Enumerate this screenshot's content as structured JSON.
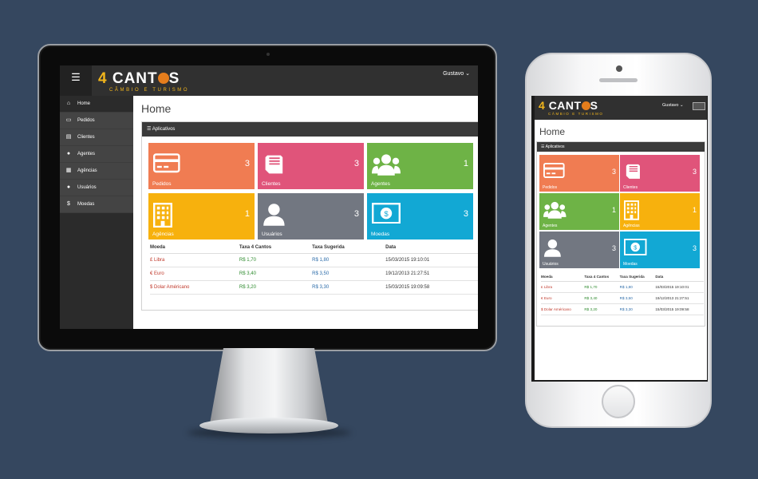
{
  "brand": {
    "number": "4",
    "name_before": "CANT",
    "name_after": "S",
    "tagline": "CÂMBIO E TURISMO"
  },
  "user": {
    "name": "Gustavo",
    "caret": "⌄"
  },
  "menu_icon": "☰",
  "page_title": "Home",
  "panel": {
    "icon": "☰",
    "title": "Aplicativos"
  },
  "sidebar": {
    "items": [
      {
        "label": "Home",
        "icon": "home-icon",
        "glyph": "⌂",
        "active": true
      },
      {
        "label": "Pedidos",
        "icon": "credit-card-icon",
        "glyph": "▭"
      },
      {
        "label": "Clientes",
        "icon": "book-icon",
        "glyph": "▤"
      },
      {
        "label": "Agentes",
        "icon": "users-icon",
        "glyph": "●"
      },
      {
        "label": "Agências",
        "icon": "building-icon",
        "glyph": "▦"
      },
      {
        "label": "Usuários",
        "icon": "user-icon",
        "glyph": "●"
      },
      {
        "label": "Moedas",
        "icon": "dollar-icon",
        "glyph": "$"
      }
    ]
  },
  "tiles": [
    {
      "label": "Pedidos",
      "value": "3",
      "color": "#f07c52",
      "icon": "credit-card-icon"
    },
    {
      "label": "Clientes",
      "value": "3",
      "color": "#e0547a",
      "icon": "book-icon"
    },
    {
      "label": "Agentes",
      "value": "1",
      "color": "#6eb346",
      "icon": "users-icon"
    },
    {
      "label": "Agências",
      "value": "1",
      "color": "#f7b10d",
      "icon": "building-icon"
    },
    {
      "label": "Usuários",
      "value": "3",
      "color": "#727781",
      "icon": "user-icon"
    },
    {
      "label": "Moedas",
      "value": "3",
      "color": "#12a8d4",
      "icon": "money-icon"
    }
  ],
  "table": {
    "headers": [
      "Moeda",
      "Taxa 4 Cantos",
      "Taxa Sugerida",
      "Data"
    ],
    "rows": [
      [
        "£ Libra",
        "R$ 1,70",
        "R$ 1,80",
        "15/03/2015 19:10:01"
      ],
      [
        "€ Euro",
        "R$ 3,40",
        "R$ 3,50",
        "19/12/2013 21:27:51"
      ],
      [
        "$ Dolar Américano",
        "R$ 3,20",
        "R$ 3,30",
        "15/03/2015 19:09:58"
      ]
    ]
  }
}
